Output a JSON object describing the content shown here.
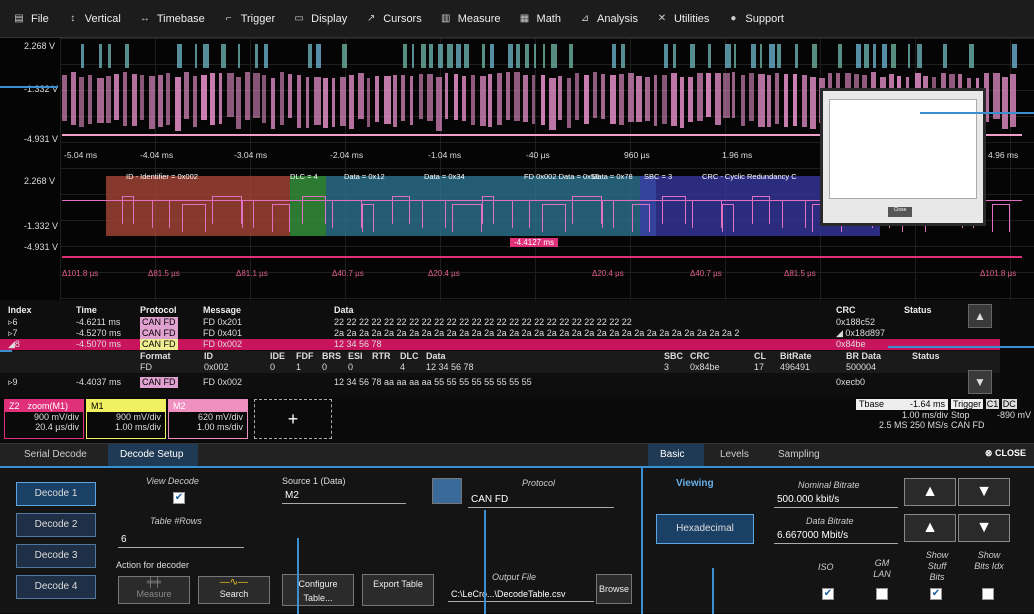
{
  "menu": [
    {
      "icon": "file-icon",
      "label": "File",
      "glyph": "▤"
    },
    {
      "icon": "vertical-icon",
      "label": "Vertical",
      "glyph": "↕"
    },
    {
      "icon": "timebase-icon",
      "label": "Timebase",
      "glyph": "↔"
    },
    {
      "icon": "trigger-icon",
      "label": "Trigger",
      "glyph": "⌐"
    },
    {
      "icon": "display-icon",
      "label": "Display",
      "glyph": "▭"
    },
    {
      "icon": "cursors-icon",
      "label": "Cursors",
      "glyph": "↗"
    },
    {
      "icon": "measure-icon",
      "label": "Measure",
      "glyph": "▥"
    },
    {
      "icon": "math-icon",
      "label": "Math",
      "glyph": "▦"
    },
    {
      "icon": "analysis-icon",
      "label": "Analysis",
      "glyph": "⊿"
    },
    {
      "icon": "utilities-icon",
      "label": "Utilities",
      "glyph": "✕"
    },
    {
      "icon": "support-icon",
      "label": "Support",
      "glyph": "●"
    }
  ],
  "waveform": {
    "top_y": [
      "2.268 V",
      "-1.332 V",
      "-4.931 V"
    ],
    "top_x": [
      "-5.04 ms",
      "-4.04 ms",
      "-3.04 ms",
      "-2.04 ms",
      "-1.04 ms",
      "-40 µs",
      "960 µs",
      "1.96 ms",
      "4.96 ms"
    ],
    "zoom_y": [
      "2.268 V",
      "-1.332 V",
      "-4.931 V"
    ],
    "zoom_fields": [
      "ID - Identifier = 0x002",
      "DLC = 4",
      "Data = 0x12",
      "Data = 0x34",
      "FD 0x002 Data = 0x56",
      "Data = 0x78",
      "SBC = 3",
      "CRC - Cyclic Redundancy C"
    ],
    "zoom_deltas": [
      "Δ101.8 µs",
      "Δ81.5 µs",
      "Δ81.1 µs",
      "Δ40.7 µs",
      "Δ20.4 µs",
      "Δ20.4 µs",
      "Δ40.7 µs",
      "Δ81.5 µs",
      "Δ101.8 µs"
    ],
    "zoom_marker": "-4.4127 ms",
    "popup_btn": "Close"
  },
  "table": {
    "headers": {
      "index": "Index",
      "time": "Time",
      "protocol": "Protocol",
      "message": "Message",
      "data": "Data",
      "crc": "CRC",
      "status": "Status"
    },
    "rows": [
      {
        "index": "▹6",
        "time": "-4.6211 ms",
        "protocol": "CAN FD",
        "message": "FD 0x201",
        "data": "22 22 22 22 22 22 22 22 22 22 22 22 22 22 22 22 22 22 22 22 22 22 22 22",
        "crc": "0x188c52"
      },
      {
        "index": "▹7",
        "time": "-4.5270 ms",
        "protocol": "CAN FD",
        "message": "FD 0x401",
        "data": "2a 2a 2a 2a 2a 2a 2a 2a 2a 2a 2a 2a 2a 2a 2a 2a 2a 2a 2a 2a 2a 2a 2a 2a 2a 2a 2a 2a 2a 2a 2a 2a 2",
        "crc": "◢ 0x18d897"
      },
      {
        "index": "◢8",
        "time": "-4.5070 ms",
        "protocol": "CAN FD",
        "message": "FD 0x002",
        "data": "12 34 56 78",
        "crc": "0x84be"
      }
    ],
    "sub_header": [
      "Format",
      "ID",
      "IDE",
      "FDF",
      "BRS",
      "ESI",
      "RTR",
      "DLC",
      "Data",
      "SBC",
      "CRC",
      "CL",
      "BitRate",
      "BR Data",
      "Status"
    ],
    "sub_row": [
      "FD",
      "0x002",
      "0",
      "1",
      "0",
      "0",
      "4",
      "12 34 56 78",
      "3",
      "0x84be",
      "17",
      "496491",
      "500004"
    ],
    "row9": {
      "index": "▹9",
      "time": "-4.4037 ms",
      "protocol": "CAN FD",
      "message": "FD 0x002",
      "data": "12 34 56 78 aa aa aa aa 55 55 55 55 55 55 55 55",
      "crc": "0xecb0"
    }
  },
  "channels": [
    {
      "title": "Z2",
      "sub": "zoom(M1)",
      "v1": "900 mV/div",
      "v2": "20.4 µs/div",
      "color": "#e0307a"
    },
    {
      "title": "M1",
      "sub": "",
      "v1": "900 mV/div",
      "v2": "1.00 ms/div",
      "color": "#f0f060"
    },
    {
      "title": "M2",
      "sub": "",
      "v1": "620 mV/div",
      "v2": "1.00 ms/div",
      "color": "#f090c0"
    }
  ],
  "add_label": "+",
  "timebase": {
    "tbase_lbl": "Tbase",
    "tbase_val": "-1.64 ms",
    "r1": "1.00 ms/div",
    "r2a": "2.5 MS",
    "r2b": "250 MS/s"
  },
  "trigger": {
    "lbl": "Trigger",
    "c1": "C1",
    "dc": "DC",
    "stop": "Stop",
    "val": "-890 mV",
    "proto": "CAN FD"
  },
  "panel": {
    "tabs_left": [
      "Serial Decode",
      "Decode Setup"
    ],
    "tabs_right": [
      "Basic",
      "Levels",
      "Sampling"
    ],
    "close": "CLOSE",
    "decoders": [
      "Decode 1",
      "Decode 2",
      "Decode 3",
      "Decode 4"
    ],
    "view_decode": "View Decode",
    "table_rows_lbl": "Table #Rows",
    "table_rows_val": "6",
    "action_lbl": "Action for decoder",
    "measure_lbl": "Measure",
    "search_lbl": "Search",
    "source_lbl": "Source 1 (Data)",
    "source_val": "M2",
    "configure": "Configure Table...",
    "export": "Export Table",
    "protocol_lbl": "Protocol",
    "protocol_val": "CAN FD",
    "output_lbl": "Output File",
    "output_val": "C:\\LeCro...\\DecodeTable.csv",
    "browse": "Browse",
    "viewing": "Viewing",
    "hex": "Hexadecimal",
    "nominal_lbl": "Nominal Bitrate",
    "nominal_val": "500.000 kbit/s",
    "data_lbl": "Data Bitrate",
    "data_val": "6.667000 Mbit/s",
    "iso": "ISO",
    "gmlan": "GM LAN",
    "stuff": "Show Stuff Bits",
    "bitsidx": "Show Bits Idx"
  }
}
